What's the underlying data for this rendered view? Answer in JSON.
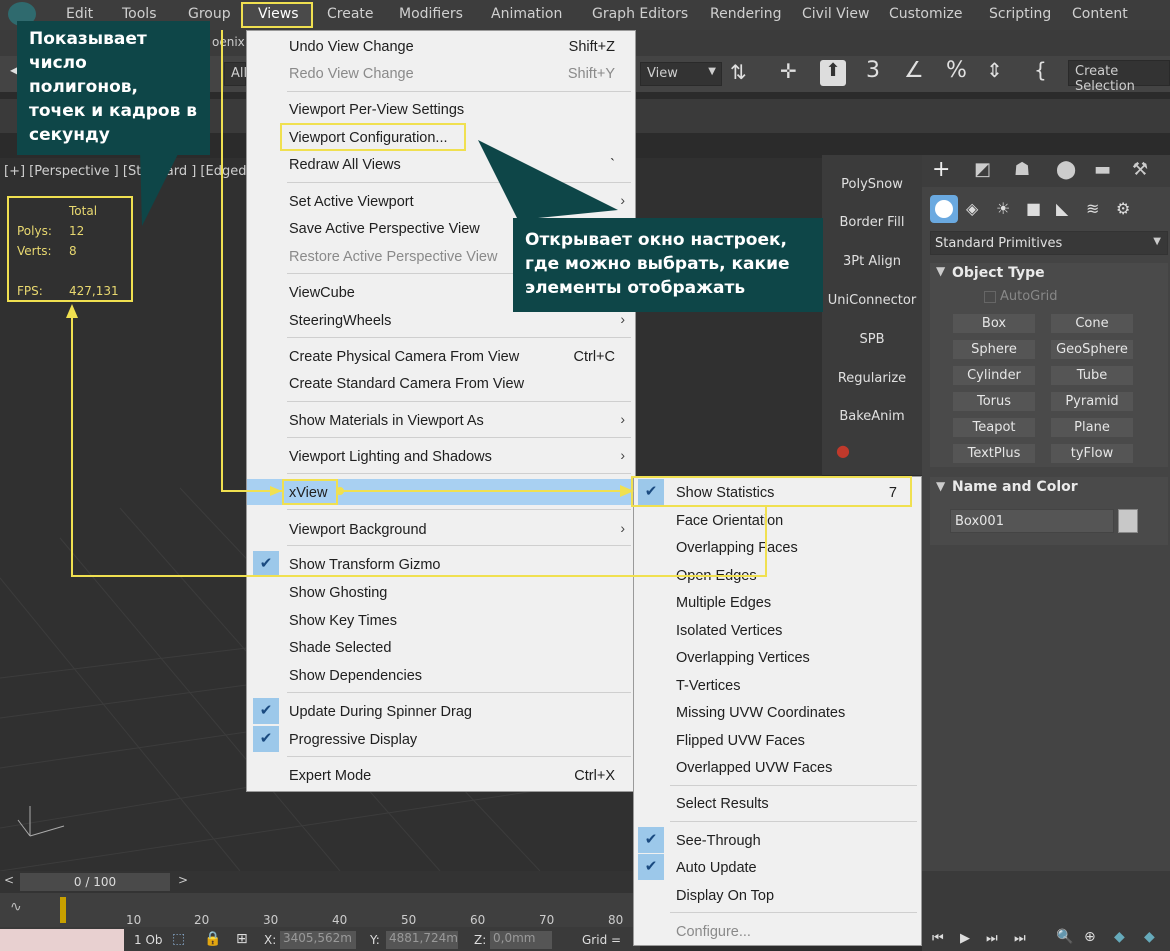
{
  "menubar": {
    "items": [
      "Edit",
      "Tools",
      "Group",
      "Views",
      "Create",
      "Modifiers",
      "Animation",
      "Graph Editors",
      "Rendering",
      "Civil View",
      "Customize",
      "Scripting",
      "Content"
    ]
  },
  "toolbar": {
    "selection_filter": "All",
    "view_dropdown": "View",
    "create_selection": "Create Selection",
    "tab_fragment": "oenix"
  },
  "viewport": {
    "label": "[+] [Perspective ] [Standard ] [Edged Fa",
    "stats": {
      "total_label": "Total",
      "polys_label": "Polys:",
      "polys_value": "12",
      "verts_label": "Verts:",
      "verts_value": "8",
      "fps_label": "FPS:",
      "fps_value": "427,131"
    }
  },
  "callouts": {
    "stats": "Показывает число полигонов, точек и кадров в секунду",
    "config": "Открывает окно настроек, где можно выбрать, какие элементы отображать"
  },
  "views_menu": {
    "items": [
      {
        "label": "Undo View Change",
        "shortcut": "Shift+Z"
      },
      {
        "label": "Redo View Change",
        "shortcut": "Shift+Y"
      },
      {
        "label": "Viewport Per-View Settings"
      },
      {
        "label": "Viewport Configuration..."
      },
      {
        "label": "Redraw All Views",
        "shortcut": "`"
      },
      {
        "label": "Set Active Viewport"
      },
      {
        "label": "Save Active Perspective View"
      },
      {
        "label": "Restore Active Perspective View"
      },
      {
        "label": "ViewCube"
      },
      {
        "label": "SteeringWheels"
      },
      {
        "label": "Create Physical Camera From View",
        "shortcut": "Ctrl+C"
      },
      {
        "label": "Create Standard Camera From View"
      },
      {
        "label": "Show Materials in Viewport As"
      },
      {
        "label": "Viewport Lighting and Shadows"
      },
      {
        "label": "xView"
      },
      {
        "label": "Viewport Background"
      },
      {
        "label": "Show Transform Gizmo"
      },
      {
        "label": "Show Ghosting"
      },
      {
        "label": "Show Key Times"
      },
      {
        "label": "Shade Selected"
      },
      {
        "label": "Show Dependencies"
      },
      {
        "label": "Update During Spinner Drag"
      },
      {
        "label": "Progressive Display"
      },
      {
        "label": "Expert Mode",
        "shortcut": "Ctrl+X"
      }
    ]
  },
  "xview_submenu": {
    "items": [
      {
        "label": "Show Statistics",
        "shortcut": "7"
      },
      {
        "label": "Face Orientation"
      },
      {
        "label": "Overlapping Faces"
      },
      {
        "label": "Open Edges"
      },
      {
        "label": "Multiple Edges"
      },
      {
        "label": "Isolated Vertices"
      },
      {
        "label": "Overlapping Vertices"
      },
      {
        "label": "T-Vertices"
      },
      {
        "label": "Missing UVW Coordinates"
      },
      {
        "label": "Flipped UVW Faces"
      },
      {
        "label": "Overlapped UVW Faces"
      },
      {
        "label": "Select Results"
      },
      {
        "label": "See-Through"
      },
      {
        "label": "Auto Update"
      },
      {
        "label": "Display On Top"
      },
      {
        "label": "Configure..."
      }
    ]
  },
  "scripts": [
    "PolySnow",
    "Border Fill",
    "3Pt Align",
    "UniConnector",
    "SPB",
    "Regularize",
    "BakeAnim"
  ],
  "command_panel": {
    "category": "Standard Primitives",
    "object_type_title": "Object Type",
    "autogrid": "AutoGrid",
    "buttons": [
      "Box",
      "Cone",
      "Sphere",
      "GeoSphere",
      "Cylinder",
      "Tube",
      "Torus",
      "Pyramid",
      "Teapot",
      "Plane",
      "TextPlus",
      "tyFlow"
    ],
    "name_color_title": "Name and Color",
    "object_name": "Box001"
  },
  "timeline": {
    "frame_counter": "0 / 100",
    "ticks": [
      "10",
      "20",
      "30",
      "40",
      "50",
      "60",
      "70",
      "80"
    ],
    "status": {
      "selected": "1 Ob",
      "x_label": "X:",
      "x_value": "3405,562m",
      "y_label": "Y:",
      "y_value": "4881,724m",
      "z_label": "Z:",
      "z_value": "0,0mm",
      "grid_label": "Grid ="
    }
  },
  "colors": {
    "highlight_yellow": "#f0e050",
    "callout_teal": "#0e4648",
    "menu_bg": "#f0f0f0",
    "menu_hover": "#a8d0f2"
  }
}
